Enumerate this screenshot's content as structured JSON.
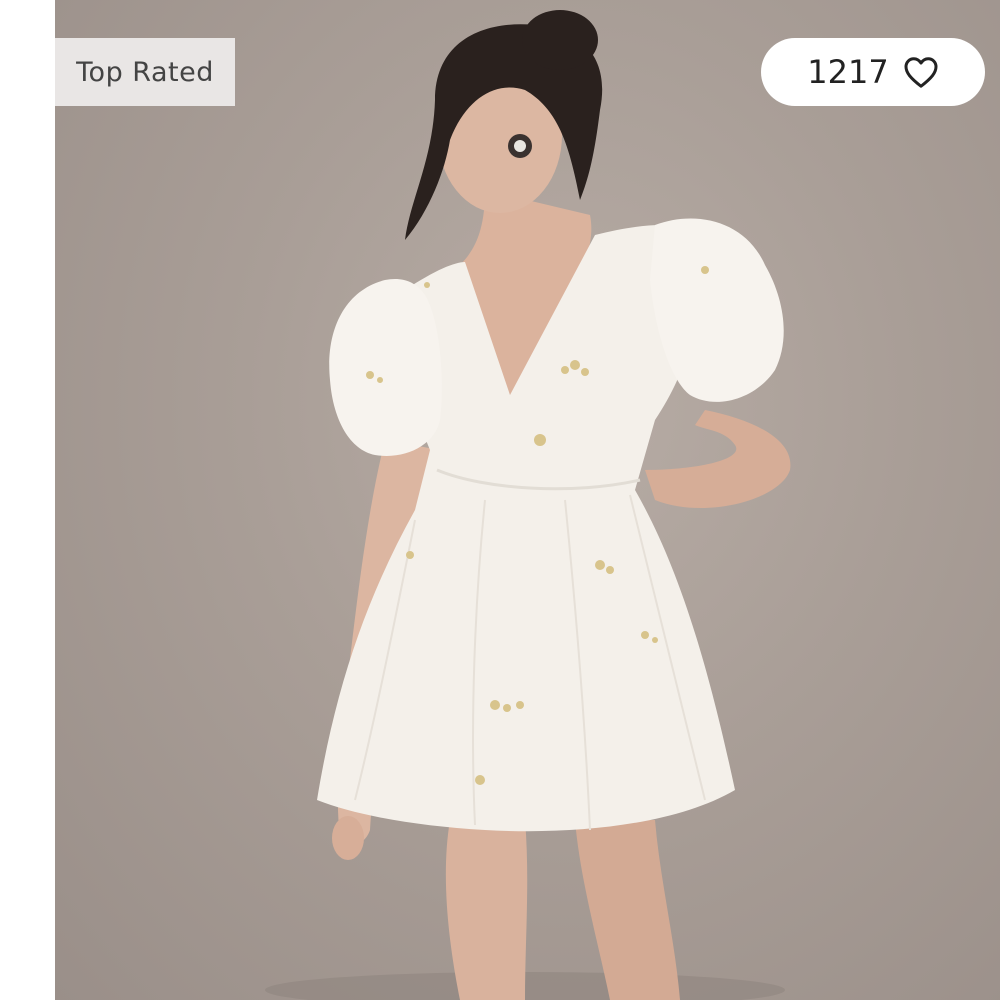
{
  "badge": {
    "label": "Top Rated"
  },
  "likes": {
    "count": "1217",
    "icon": "heart-outline-icon"
  },
  "colors": {
    "backdrop": "#a99e97",
    "badge_bg": "#e9e6e5",
    "pill_bg": "#ffffff",
    "dress": "#f4f0ea",
    "embroidery": "#d8c48c"
  }
}
